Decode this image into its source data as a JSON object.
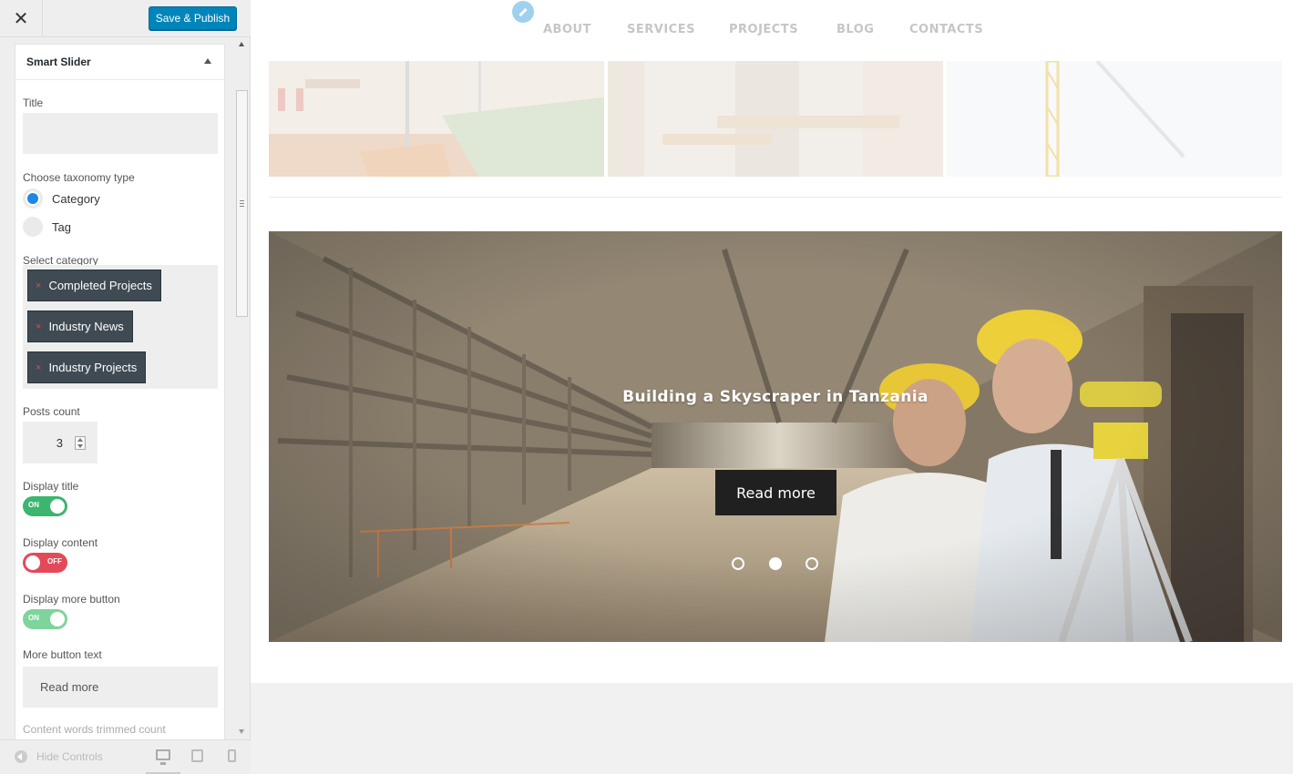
{
  "topbar": {
    "close_label": "✕",
    "publish_label": "Save & Publish"
  },
  "panel": {
    "title": "Smart Slider",
    "title_label": "Title",
    "title_value": "",
    "taxonomy_label": "Choose taxonomy type",
    "taxonomy_options": [
      {
        "label": "Category",
        "selected": true
      },
      {
        "label": "Tag",
        "selected": false
      }
    ],
    "category_label": "Select category",
    "categories": [
      "Completed Projects",
      "Industry News",
      "Industry Projects"
    ],
    "remove_glyph": "×",
    "posts_count_label": "Posts count",
    "posts_count": "3",
    "display_title": {
      "label": "Display title",
      "state": "ON"
    },
    "display_content": {
      "label": "Display content",
      "state": "OFF"
    },
    "display_more": {
      "label": "Display more button",
      "state": "ON"
    },
    "more_text_label": "More button text",
    "more_text_value": "Read more",
    "trim_label": "Content words trimmed count"
  },
  "footer": {
    "hide_controls": "Hide Controls"
  },
  "nav": {
    "items": [
      "ABOUT",
      "SERVICES",
      "PROJECTS",
      "BLOG",
      "CONTACTS"
    ]
  },
  "slider": {
    "title": "Building a Skyscraper in Tanzania",
    "button": "Read more",
    "dots": 3,
    "active_dot": 2
  },
  "colors": {
    "publish": "#0085ba",
    "toggle_on": "#3cb56f",
    "toggle_off": "#e24a5a",
    "chip": "#3f4a52",
    "radio": "#1e87e5"
  }
}
